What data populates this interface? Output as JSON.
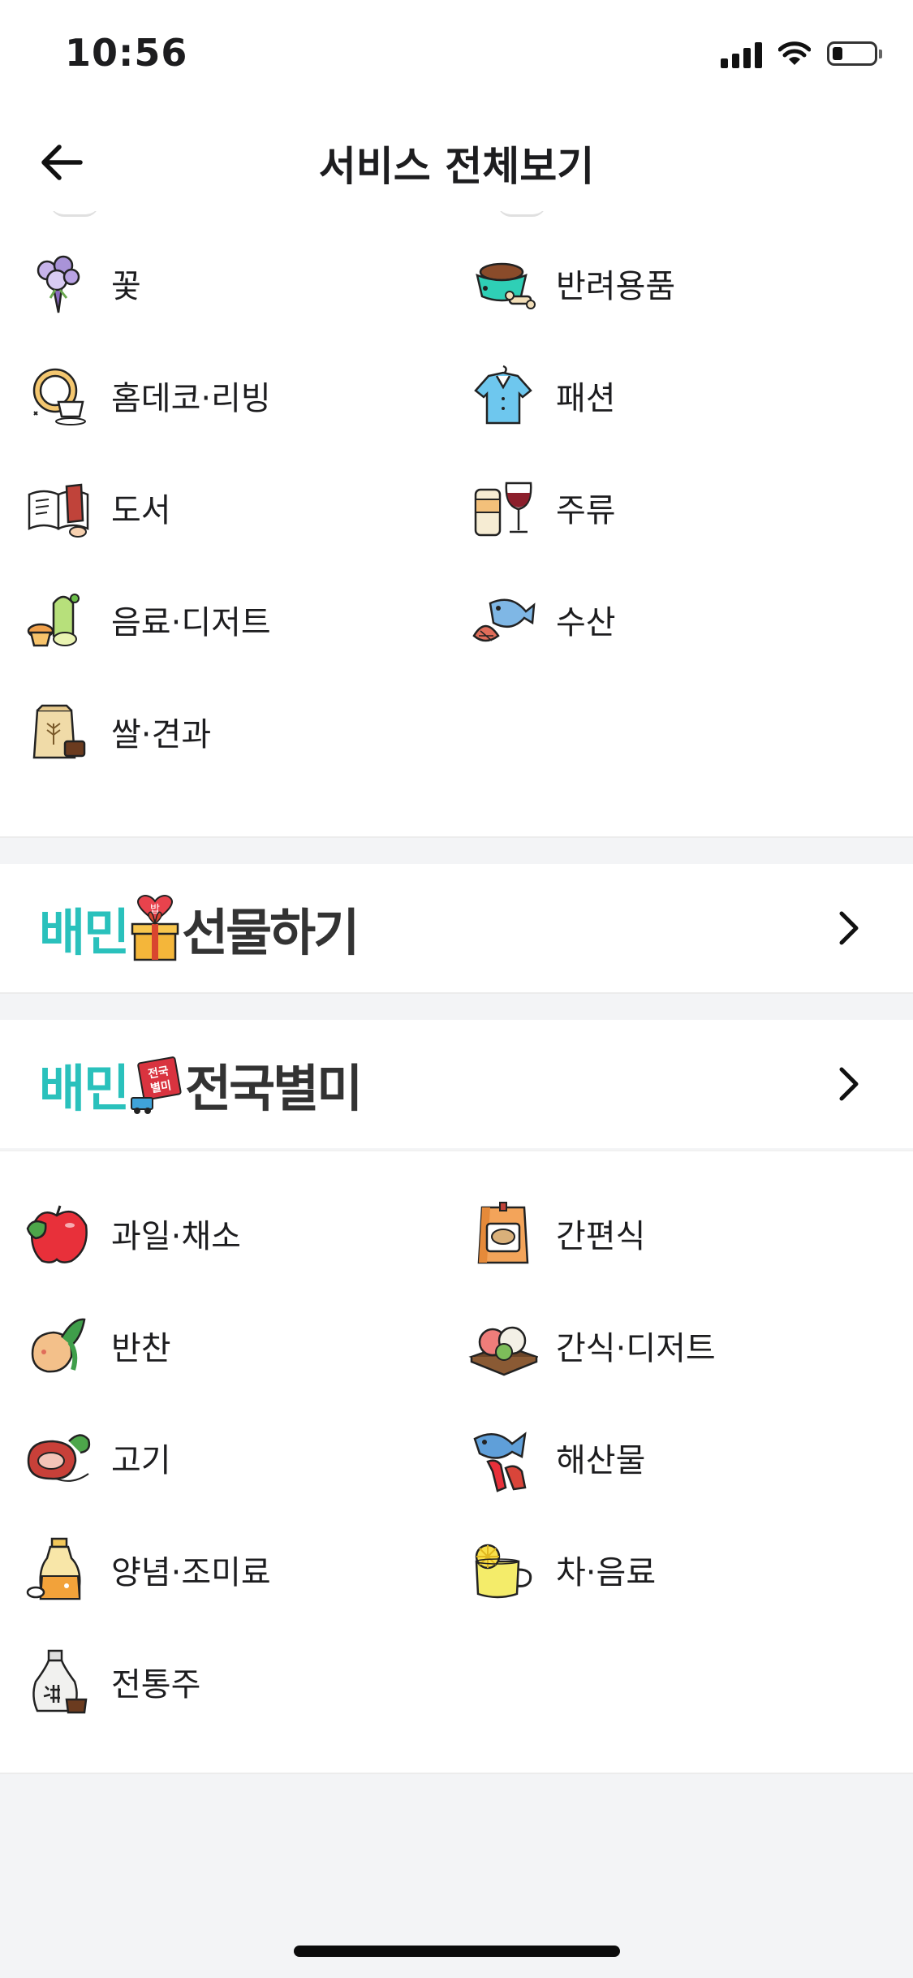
{
  "status_bar": {
    "time": "10:56"
  },
  "header": {
    "title": "서비스 전체보기"
  },
  "section1": {
    "items": [
      {
        "label": "꽃",
        "icon": "flower-bouquet-icon"
      },
      {
        "label": "반려용품",
        "icon": "pet-bowl-icon"
      },
      {
        "label": "홈데코·리빙",
        "icon": "home-decor-icon"
      },
      {
        "label": "패션",
        "icon": "shirt-icon"
      },
      {
        "label": "도서",
        "icon": "book-icon"
      },
      {
        "label": "주류",
        "icon": "liquor-icon"
      },
      {
        "label": "음료·디저트",
        "icon": "dessert-icon"
      },
      {
        "label": "수산",
        "icon": "fish-icon"
      },
      {
        "label": "쌀·견과",
        "icon": "rice-bag-icon"
      }
    ]
  },
  "gift_banner": {
    "brand": "배민",
    "title": "선물하기",
    "heart_badge": "밥"
  },
  "nationwide_banner": {
    "brand": "배민",
    "title": "전국별미",
    "sign_text_1": "전국",
    "sign_text_2": "별미"
  },
  "section3": {
    "items": [
      {
        "label": "과일·채소",
        "icon": "apple-icon"
      },
      {
        "label": "간편식",
        "icon": "ready-meal-icon"
      },
      {
        "label": "반찬",
        "icon": "side-dish-icon"
      },
      {
        "label": "간식·디저트",
        "icon": "rice-cake-icon"
      },
      {
        "label": "고기",
        "icon": "meat-icon"
      },
      {
        "label": "해산물",
        "icon": "seafood-icon"
      },
      {
        "label": "양념·조미료",
        "icon": "seasoning-icon"
      },
      {
        "label": "차·음료",
        "icon": "tea-icon"
      },
      {
        "label": "전통주",
        "icon": "traditional-liquor-icon"
      }
    ]
  },
  "colors": {
    "brand_mint": "#2ac1bc",
    "background": "#f3f4f6",
    "text": "#1d1d1f"
  }
}
